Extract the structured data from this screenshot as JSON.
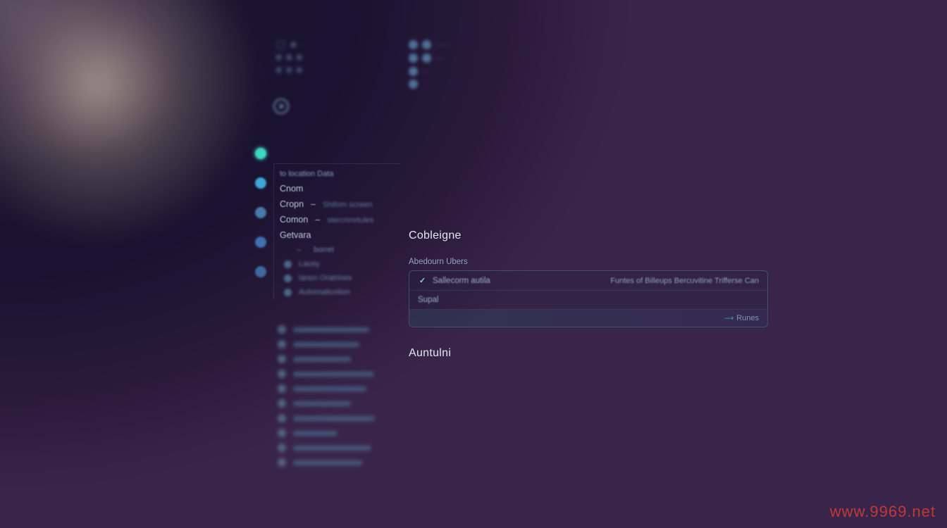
{
  "watermark": "www.9969.net",
  "rail_colors": [
    "#3fd8c0",
    "#3fa8d8",
    "#4a7aa8",
    "#3f70b0",
    "#3f6aa0"
  ],
  "sidebar": {
    "header": "to location Data",
    "items": [
      {
        "label": "Cnom"
      },
      {
        "label": "Cropn",
        "desc": "Shifom screen"
      },
      {
        "label": "Comon",
        "desc": "stercrimrtules"
      },
      {
        "label": "Getvara"
      }
    ],
    "sub": {
      "left": "–",
      "right": "borret"
    },
    "lines": [
      "Lacey",
      "lanon Oratrines",
      "Automaticotion"
    ],
    "list_count": 10
  },
  "main": {
    "section_title": "Cobleigne",
    "field_label": "Abedourn Ubers",
    "row1_left": "Sallecorm autila",
    "row1_right": "Funtes of Billeups   Bercuvitine Trifferse Can",
    "row2_left": "Supal",
    "run_label": "Runes",
    "sub_section": "Auntulni"
  }
}
